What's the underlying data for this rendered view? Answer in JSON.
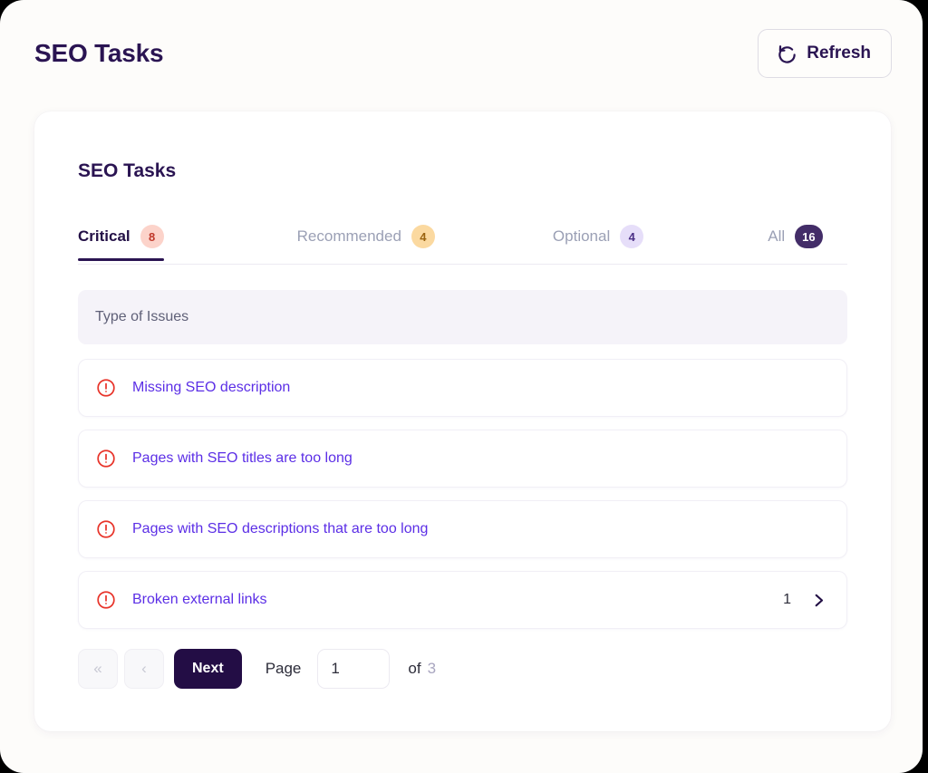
{
  "header": {
    "title": "SEO Tasks",
    "refresh": {
      "label": "Refresh",
      "icon": "refresh-ccw-icon"
    }
  },
  "card": {
    "title": "SEO Tasks",
    "tabs": [
      {
        "label": "Critical",
        "count": "8",
        "active": true,
        "style": "critical"
      },
      {
        "label": "Recommended",
        "count": "4",
        "active": false,
        "style": "recommended"
      },
      {
        "label": "Optional",
        "count": "4",
        "active": false,
        "style": "optional"
      },
      {
        "label": "All",
        "count": "16",
        "active": false,
        "style": "all"
      }
    ],
    "table": {
      "column_header": "Type of Issues",
      "rows": [
        {
          "icon": "alert-circle-icon",
          "label": "Missing SEO description",
          "count": ""
        },
        {
          "icon": "alert-circle-icon",
          "label": "Pages with SEO titles are too long",
          "count": ""
        },
        {
          "icon": "alert-circle-icon",
          "label": "Pages with SEO descriptions that are too long",
          "count": ""
        },
        {
          "icon": "alert-circle-icon",
          "label": "Broken external links",
          "count": "1"
        }
      ]
    },
    "pagination": {
      "first_label": "«",
      "prev_label": "‹",
      "next_label": "Next",
      "page_label": "Page",
      "page_value": "1",
      "of_label": "of",
      "total_pages": "3"
    }
  },
  "colors": {
    "brand_dark": "#2a1452",
    "page_bg": "#fdfcfa",
    "card_bg": "#ffffff",
    "link_purple": "#5b2ee6",
    "alert_red": "#e8342a",
    "badge_critical_bg": "#fcd3ca",
    "badge_recommended_bg": "#fbd9a0",
    "badge_optional_bg": "#e6def9",
    "badge_all_bg": "#432d68"
  }
}
